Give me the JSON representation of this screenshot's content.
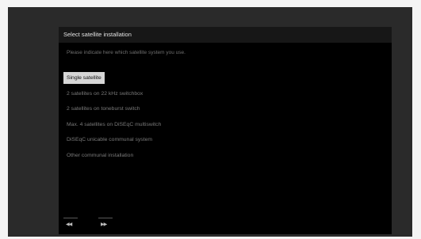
{
  "dialog": {
    "title": "Select satellite installation",
    "subtitle": "Please indicate here which satellite system you use.",
    "options": [
      "Single satellite",
      "2 satellites on 22 kHz switchbox",
      "2 satellites on toneburst switch",
      "Max. 4 satellites on DiSEqC multiswitch",
      "DiSEqC unicable communal system",
      "Other communal installation"
    ],
    "selected_index": 0
  },
  "nav": {
    "back_icon": "rewind-icon",
    "back_glyph": "◀◀",
    "forward_icon": "fast-forward-icon",
    "forward_glyph": "▶▶"
  },
  "colors": {
    "selected_bg": "#d6d6d6",
    "dialog_bg": "#000000",
    "frame_bg": "#2a2a2a"
  }
}
